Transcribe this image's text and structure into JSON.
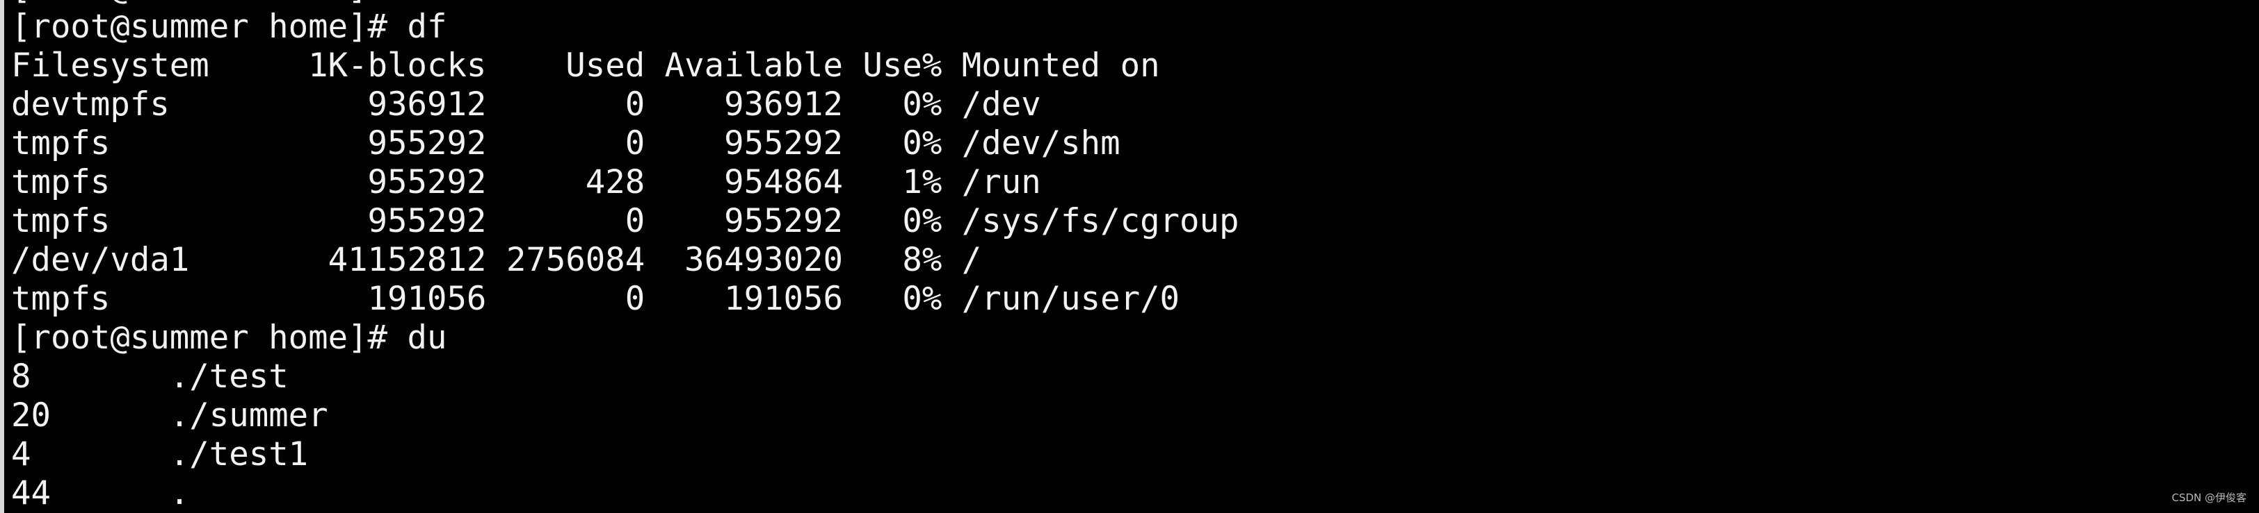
{
  "terminal": {
    "lines": [
      "[root@summer home]#",
      "[root@summer home]# df",
      "Filesystem     1K-blocks    Used Available Use% Mounted on",
      "devtmpfs          936912       0    936912   0% /dev",
      "tmpfs             955292       0    955292   0% /dev/shm",
      "tmpfs             955292     428    954864   1% /run",
      "tmpfs             955292       0    955292   0% /sys/fs/cgroup",
      "/dev/vda1       41152812 2756084  36493020   8% /",
      "tmpfs             191056       0    191056   0% /run/user/0",
      "[root@summer home]# du",
      "8\t./test",
      "20\t./summer",
      "4\t./test1",
      "44\t."
    ]
  },
  "watermark": "CSDN @伊俊客"
}
